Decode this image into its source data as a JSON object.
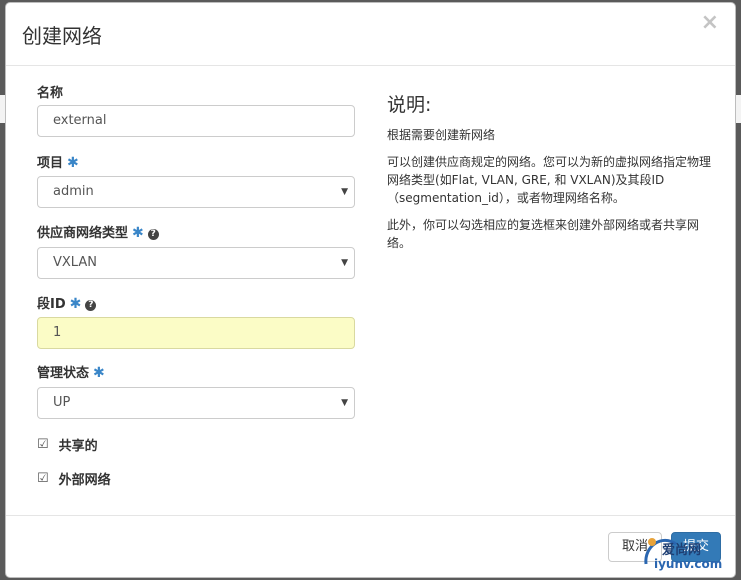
{
  "modal": {
    "title": "创建网络"
  },
  "form": {
    "name": {
      "label": "名称",
      "value": "external"
    },
    "project": {
      "label": "项目",
      "value": "admin"
    },
    "provider_network_type": {
      "label": "供应商网络类型",
      "value": "VXLAN"
    },
    "segment_id": {
      "label": "段ID",
      "value": "1"
    },
    "admin_state": {
      "label": "管理状态",
      "value": "UP"
    },
    "shared": {
      "label": "共享的",
      "checked": true
    },
    "external_network": {
      "label": "外部网络",
      "checked": true
    }
  },
  "description": {
    "title": "说明:",
    "paragraphs": [
      "根据需要创建新网络",
      "可以创建供应商规定的网络。您可以为新的虚拟网络指定物理网络类型(如Flat, VLAN, GRE, 和 VXLAN)及其段ID（segmentation_id），或者物理网络名称。",
      "此外，你可以勾选相应的复选框来创建外部网络或者共享网络。"
    ]
  },
  "footer": {
    "cancel_label": "取消",
    "submit_label": "提交"
  },
  "watermark": {
    "site_text": "爱尚网",
    "domain_text": "iyunv.com"
  },
  "icons": {
    "close": "close-icon",
    "required": "asterisk-icon",
    "help": "question-circle-icon",
    "select": "caret-down-icon",
    "checkbox": "check-square-icon"
  },
  "colors": {
    "primary": "#337ab7",
    "required": "#3a86c8",
    "highlight_input": "#fbfcc6"
  }
}
